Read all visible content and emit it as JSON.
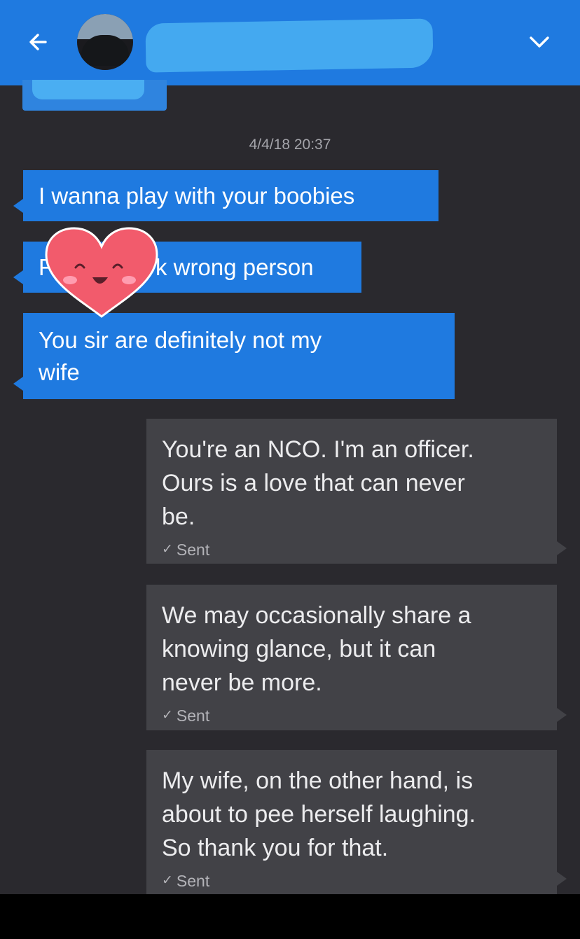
{
  "header": {
    "back_icon": "arrow-left-icon",
    "menu_icon": "chevron-down-icon",
    "color": "#1f7ae0"
  },
  "conversation": {
    "timestamp": "4/4/18 20:37",
    "received": [
      {
        "text": "I wanna play with your boobies"
      },
      {
        "text_before_sticker": "F",
        "text_after_sticker": "k wrong person"
      },
      {
        "lines": [
          "You sir are definitely not my",
          "wife"
        ]
      }
    ],
    "sent": [
      {
        "lines": [
          "You're an NCO.  I'm an officer.",
          "Ours is a love that can never",
          "be."
        ],
        "status": "Sent"
      },
      {
        "lines": [
          "We may occasionally share a",
          "knowing glance, but it can",
          "never be more."
        ],
        "status": "Sent"
      },
      {
        "lines": [
          "My wife, on the other hand, is",
          "about to pee herself laughing.",
          "So thank you for that."
        ],
        "status": "Sent"
      }
    ],
    "status_icon": "checkmark-icon",
    "sticker": "smiling-heart-sticker"
  },
  "colors": {
    "incoming_bubble": "#1f7ae0",
    "outgoing_bubble": "#424247",
    "background": "#2a292e"
  }
}
